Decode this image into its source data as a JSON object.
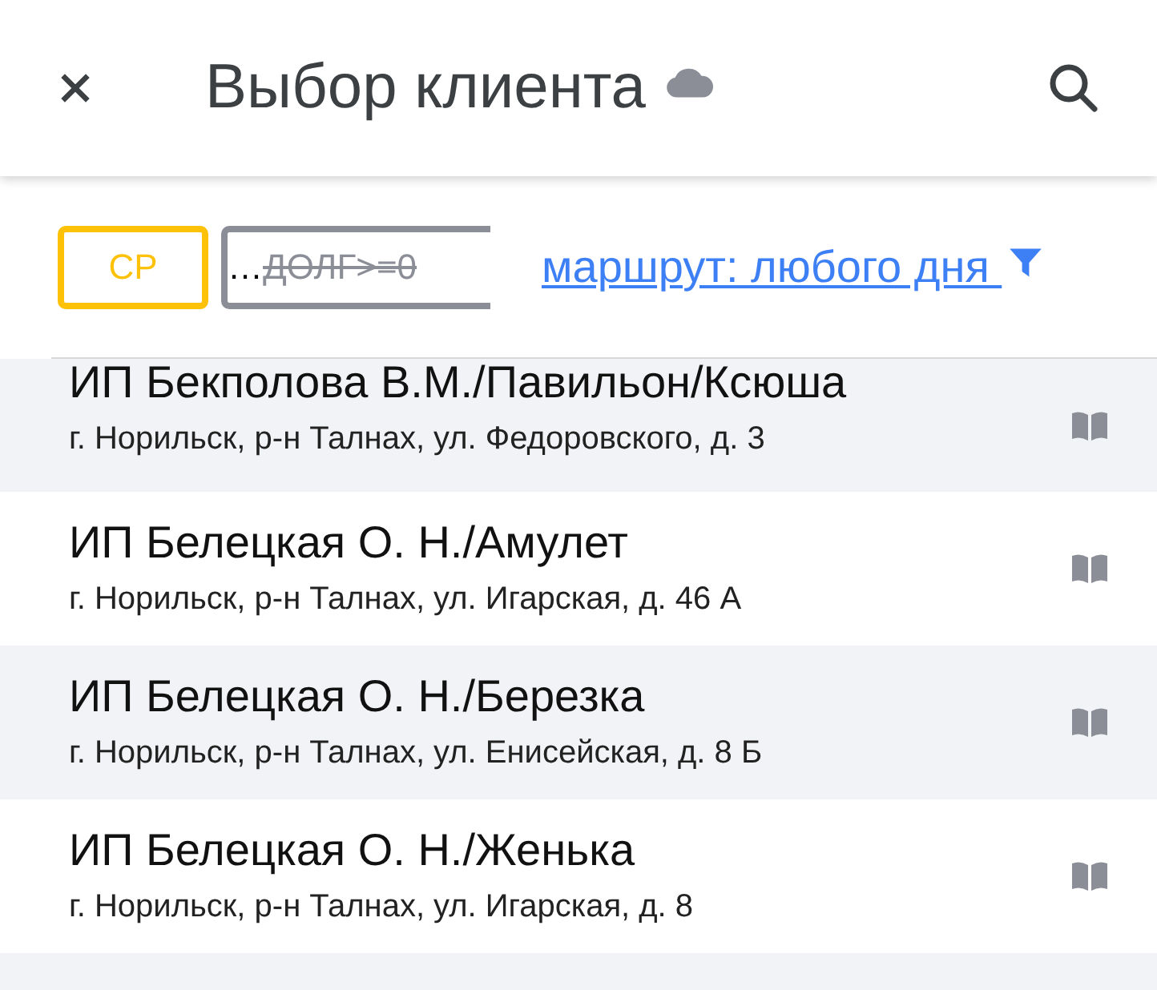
{
  "header": {
    "title": "Выбор клиента",
    "synced": true
  },
  "filters": [
    {
      "label": "СР",
      "kind": "active",
      "crossed_out": false
    },
    {
      "prefix": "…",
      "label": "ДОЛГ>=0",
      "kind": "inactive",
      "crossed_out": true
    }
  ],
  "route_filter": {
    "label": "маршрут: любого дня "
  },
  "clients": [
    {
      "name": "ИП Бекполова В.М./Павильон/Ксюша",
      "address": "г. Норильск, р-н Талнах, ул. Федоровского, д. 3"
    },
    {
      "name": "ИП Белецкая О. Н./Амулет",
      "address": "г. Норильск, р-н Талнах, ул. Игарская, д. 46 А"
    },
    {
      "name": "ИП Белецкая О. Н./Березка",
      "address": "г. Норильск, р-н Талнах, ул. Енисейская, д. 8 Б"
    },
    {
      "name": "ИП Белецкая О. Н./Женька",
      "address": "г. Норильск, р-н Талнах, ул. Игарская, д. 8"
    }
  ]
}
